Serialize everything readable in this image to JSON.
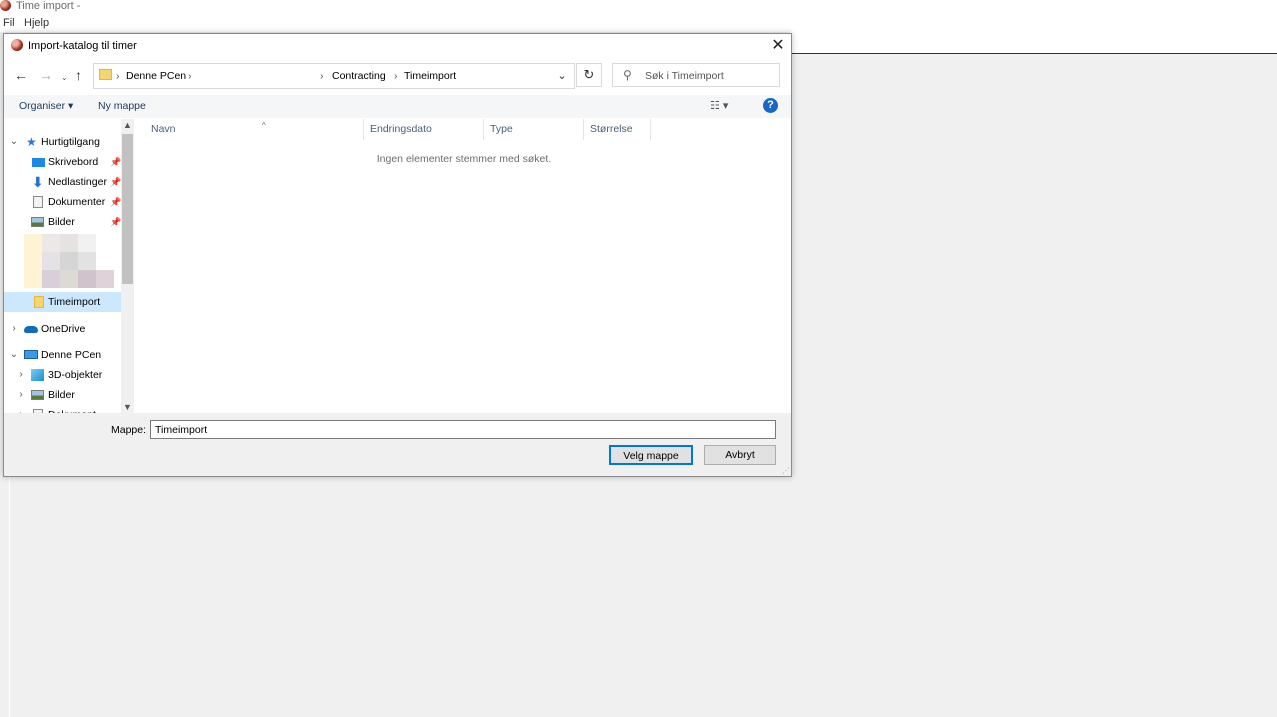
{
  "app": {
    "title": "Time import -",
    "menu": [
      "Fil",
      "Hjelp"
    ]
  },
  "dialog": {
    "title": "Import-katalog til timer",
    "address": {
      "segments": [
        "Denne PCen",
        "Contracting",
        "Timeimport"
      ]
    },
    "search": {
      "placeholder": "Søk i Timeimport"
    },
    "toolbar": {
      "organize": "Organiser ▾",
      "new_folder": "Ny mappe",
      "help": "?"
    },
    "nav": {
      "quick_access": "Hurtigtilgang",
      "desktop": "Skrivebord",
      "downloads": "Nedlastinger",
      "documents": "Dokumenter",
      "pictures": "Bilder",
      "timeimport": "Timeimport",
      "onedrive": "OneDrive",
      "this_pc": "Denne PCen",
      "objects3d": "3D-objekter",
      "pictures2": "Bilder",
      "documents2": "Dokument"
    },
    "columns": [
      "Navn",
      "Endringsdato",
      "Type",
      "Størrelse"
    ],
    "empty_message": "Ingen elementer stemmer med søket.",
    "folder_label": "Mappe:",
    "folder_value": "Timeimport",
    "select_button": "Velg mappe",
    "cancel_button": "Avbryt"
  },
  "colors": {
    "accent": "#0078d7",
    "selection": "#cce8ff",
    "folder": "#f7d56c",
    "help": "#1766c8"
  }
}
